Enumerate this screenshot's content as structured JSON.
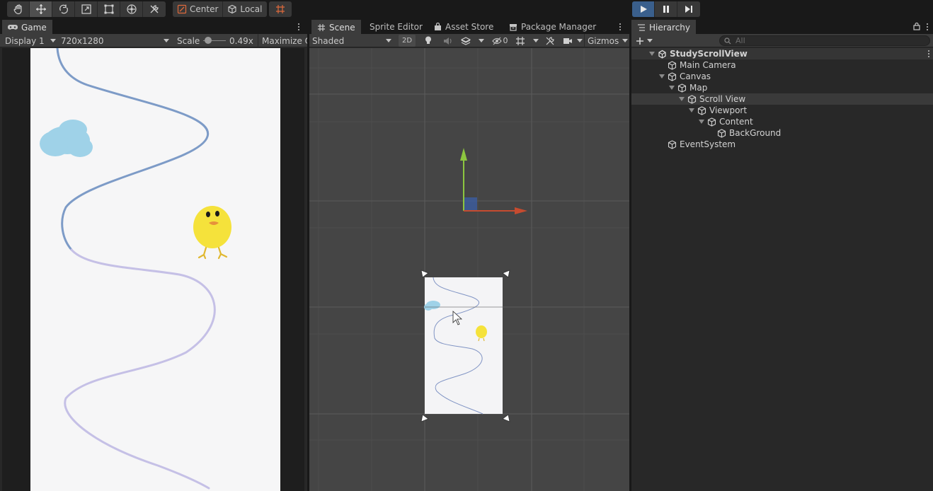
{
  "toolbar": {
    "transform_tools": [
      "hand-icon",
      "move-icon",
      "rotate-icon",
      "scale-icon",
      "rect-icon",
      "transform-icon",
      "custom-editor-tool-icon"
    ],
    "pivot_label": "Center",
    "space_label": "Local",
    "grid_snap_icon": "grid-snap-icon",
    "play_controls": [
      "play-icon",
      "pause-icon",
      "step-icon"
    ],
    "accent": "#3a5f8c"
  },
  "game": {
    "tab_label": "Game",
    "display_label": "Display 1",
    "resolution_label": "720x1280",
    "scale_label": "Scale",
    "scale_value": "0.49x",
    "scale_slider_level": 0.1,
    "maximize_label": "Maximize O",
    "canvas_bg": "#f6f6f7"
  },
  "scene": {
    "tabs": [
      {
        "label": "Scene",
        "icon": "grid-icon"
      },
      {
        "label": "Sprite Editor",
        "icon": ""
      },
      {
        "label": "Asset Store",
        "icon": "bag-icon"
      },
      {
        "label": "Package Manager",
        "icon": "package-icon"
      }
    ],
    "shading_mode": "Shaded",
    "mode_2d": "2D",
    "hidden_count": "0",
    "gizmos_label": "Gizmos",
    "bg": "#454545"
  },
  "hierarchy": {
    "tab_label": "Hierarchy",
    "search_placeholder": "All",
    "items": [
      {
        "label": "StudyScrollView",
        "depth": 0,
        "expanded": true,
        "type": "scene"
      },
      {
        "label": "Main Camera",
        "depth": 1,
        "expanded": false,
        "type": "object"
      },
      {
        "label": "Canvas",
        "depth": 1,
        "expanded": true,
        "type": "object"
      },
      {
        "label": "Map",
        "depth": 2,
        "expanded": true,
        "type": "object"
      },
      {
        "label": "Scroll View",
        "depth": 3,
        "expanded": true,
        "type": "object",
        "selected": true
      },
      {
        "label": "Viewport",
        "depth": 4,
        "expanded": true,
        "type": "object"
      },
      {
        "label": "Content",
        "depth": 5,
        "expanded": true,
        "type": "object"
      },
      {
        "label": "BackGround",
        "depth": 6,
        "expanded": false,
        "type": "object"
      },
      {
        "label": "EventSystem",
        "depth": 1,
        "expanded": false,
        "type": "object"
      }
    ]
  }
}
